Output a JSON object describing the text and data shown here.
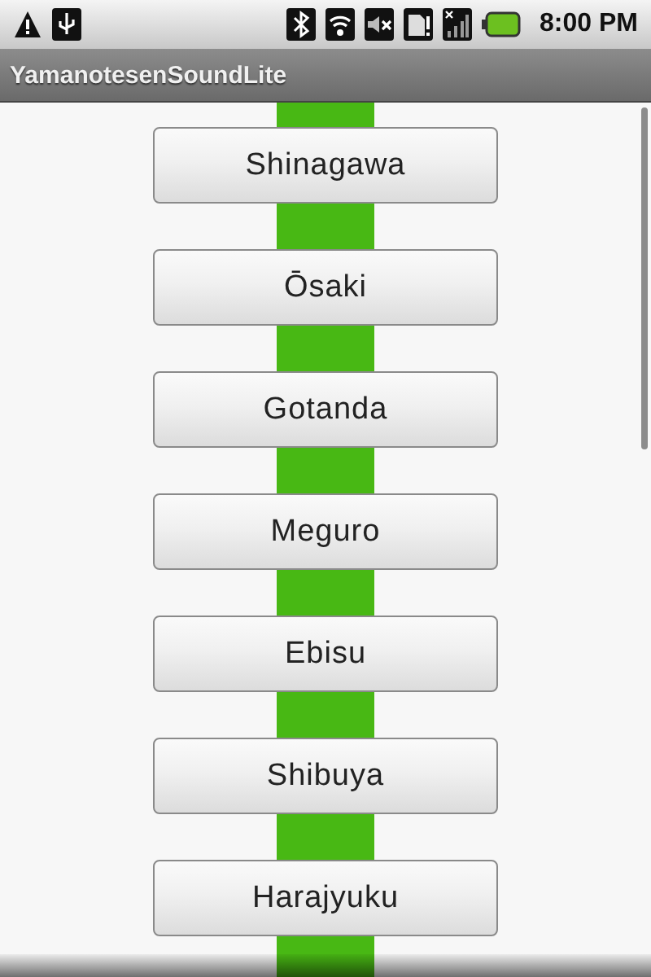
{
  "status_bar": {
    "time": "8:00 PM"
  },
  "title_bar": {
    "title": "YamanotesenSoundLite"
  },
  "stations": [
    {
      "name": "Shinagawa"
    },
    {
      "name": "Ōsaki"
    },
    {
      "name": "Gotanda"
    },
    {
      "name": "Meguro"
    },
    {
      "name": "Ebisu"
    },
    {
      "name": "Shibuya"
    },
    {
      "name": "Harajyuku"
    }
  ]
}
